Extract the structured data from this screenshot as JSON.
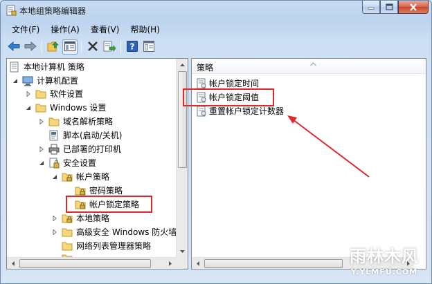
{
  "window": {
    "title": "本地组策略编辑器"
  },
  "menu": [
    {
      "label": "文件(F)"
    },
    {
      "label": "操作(A)"
    },
    {
      "label": "查看(V)"
    },
    {
      "label": "帮助(H)"
    }
  ],
  "toolbar": {
    "buttons": [
      "back-icon",
      "forward-icon",
      "up-folder-icon",
      "show-tree-icon",
      "delete-icon",
      "export-list-icon",
      "help-icon",
      "properties-icon"
    ]
  },
  "tree": [
    {
      "label": "本地计算机 策略",
      "icon": "computer-policy-icon",
      "toggle": "none"
    },
    {
      "label": "计算机配置",
      "icon": "computer-icon",
      "toggle": "expanded"
    },
    {
      "label": "软件设置",
      "icon": "folder-icon",
      "toggle": "collapsed"
    },
    {
      "label": "Windows 设置",
      "icon": "folder-icon",
      "toggle": "expanded"
    },
    {
      "label": "域名解析策略",
      "icon": "folder-icon",
      "toggle": "collapsed"
    },
    {
      "label": "脚本(启动/关机)",
      "icon": "script-icon",
      "toggle": "none"
    },
    {
      "label": "已部署的打印机",
      "icon": "printer-icon",
      "toggle": "collapsed"
    },
    {
      "label": "安全设置",
      "icon": "security-icon",
      "toggle": "expanded"
    },
    {
      "label": "帐户策略",
      "icon": "lock-folder-icon",
      "toggle": "expanded"
    },
    {
      "label": "密码策略",
      "icon": "lock-folder-icon",
      "toggle": "none"
    },
    {
      "label": "帐户锁定策略",
      "icon": "lock-folder-icon",
      "toggle": "none",
      "selected": true
    },
    {
      "label": "本地策略",
      "icon": "lock-folder-icon",
      "toggle": "collapsed"
    },
    {
      "label": "高级安全 Windows 防火墙",
      "icon": "folder-icon",
      "toggle": "collapsed"
    },
    {
      "label": "网络列表管理器策略",
      "icon": "folder-icon",
      "toggle": "none"
    }
  ],
  "list": {
    "column": "策略",
    "items": [
      {
        "label": "帐户锁定时间",
        "icon": "policy-doc-icon"
      },
      {
        "label": "帐户锁定阈值",
        "icon": "policy-doc-icon",
        "highlighted": true
      },
      {
        "label": "重置帐户锁定计数器",
        "icon": "policy-doc-icon"
      }
    ]
  },
  "watermark": {
    "main": "雨林木风",
    "sub": "Y.YLMFU.COM"
  },
  "colors": {
    "annotation": "#e0282b",
    "window_frame": "#c9dcf2",
    "selection_box": "#e0282b"
  }
}
